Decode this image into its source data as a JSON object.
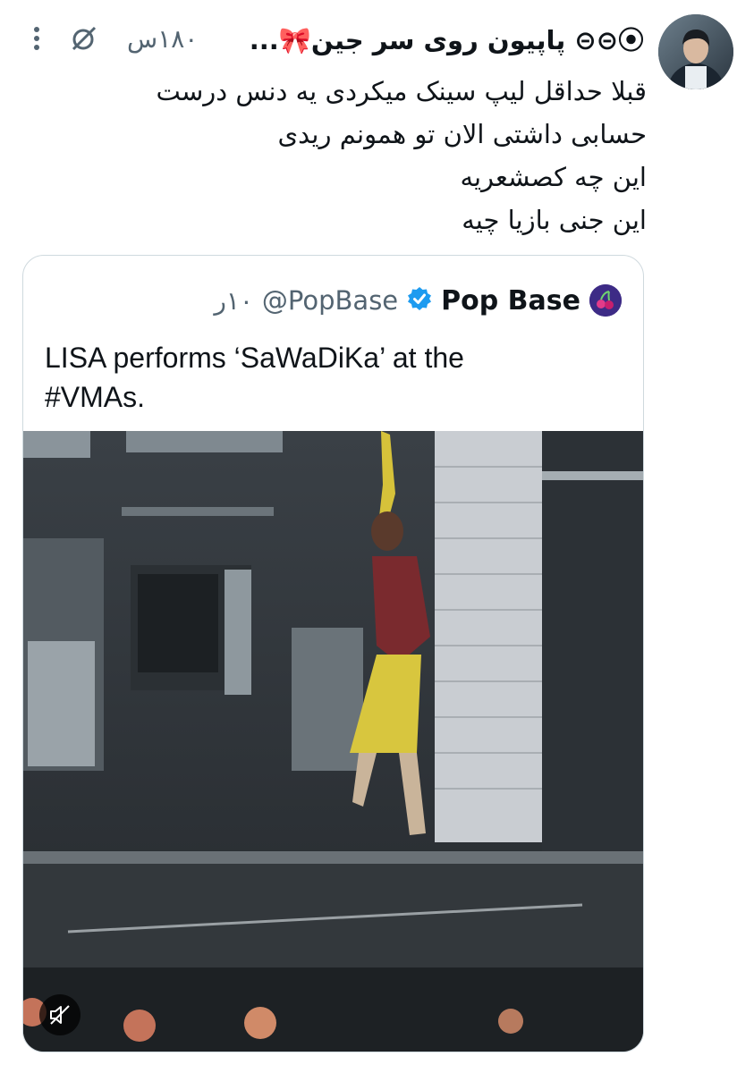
{
  "tweet": {
    "author": {
      "display_name": "⦿⊝⊝ پاپیون روی سر جین🎀..."
    },
    "timestamp": "۱۸۰س",
    "lines": [
      "قبلا حداقل لیپ سینک میکردی یه دنس درست",
      "حسابی داشتی الان تو همونم ریدی",
      "این چه کصشعریه",
      "این جنی بازیا چیه"
    ]
  },
  "quote": {
    "display_name": "Pop Base",
    "handle": "@PopBase",
    "timestamp": "۱۰ر",
    "text_lines": [
      "LISA performs ‘SaWaDiKa’ at the",
      "#VMAs."
    ]
  },
  "icons": {
    "more": "more-vertical-icon",
    "grok": "grok-icon",
    "verified": "verified-badge-icon",
    "mute": "volume-muted-icon"
  },
  "colors": {
    "verified": "#1d9bf0",
    "secondary_text": "#536471",
    "primary_text": "#0f1419"
  }
}
